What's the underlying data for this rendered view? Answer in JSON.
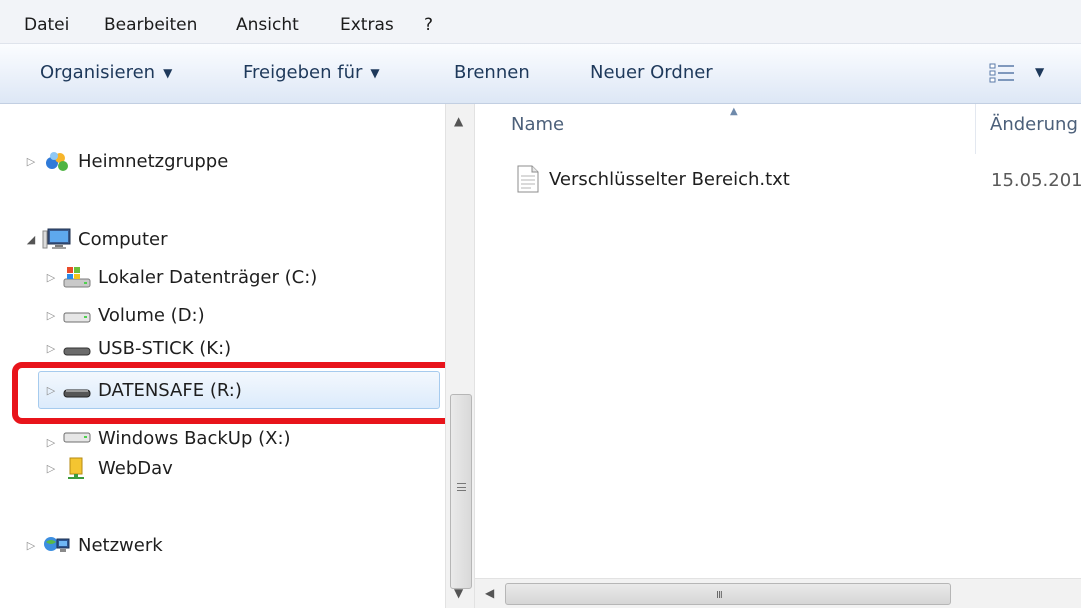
{
  "menu": [
    "Datei",
    "Bearbeiten",
    "Ansicht",
    "Extras",
    "?"
  ],
  "toolbar": {
    "organize": "Organisieren",
    "share": "Freigeben für",
    "burn": "Brennen",
    "new_folder": "Neuer Ordner",
    "caret": "▼"
  },
  "nav": {
    "homegroup": "Heimnetzgruppe",
    "computer": "Computer",
    "drives": [
      {
        "label": "Lokaler Datenträger (C:)",
        "icon": "windows-drive-icon"
      },
      {
        "label": "Volume (D:)",
        "icon": "hard-drive-icon"
      },
      {
        "label": "USB-STICK (K:)",
        "icon": "usb-drive-icon"
      },
      {
        "label": "DATENSAFE (R:)",
        "icon": "usb-drive-icon"
      },
      {
        "label": "Windows BackUp (X:)",
        "icon": "hard-drive-icon"
      },
      {
        "label": "WebDav",
        "icon": "network-folder-icon"
      }
    ],
    "network": "Netzwerk",
    "selected": "DATENSAFE (R:)",
    "highlight_color": "#e8141b"
  },
  "content": {
    "columns": [
      "Name",
      "Änderung"
    ],
    "files": [
      {
        "name": "Verschlüsselter Bereich.txt",
        "modified": "15.05.201"
      }
    ]
  },
  "colors": {
    "selection_fill": "#dcebfc",
    "selection_border": "#a6cbee",
    "toolbar_text": "#1e395b"
  }
}
